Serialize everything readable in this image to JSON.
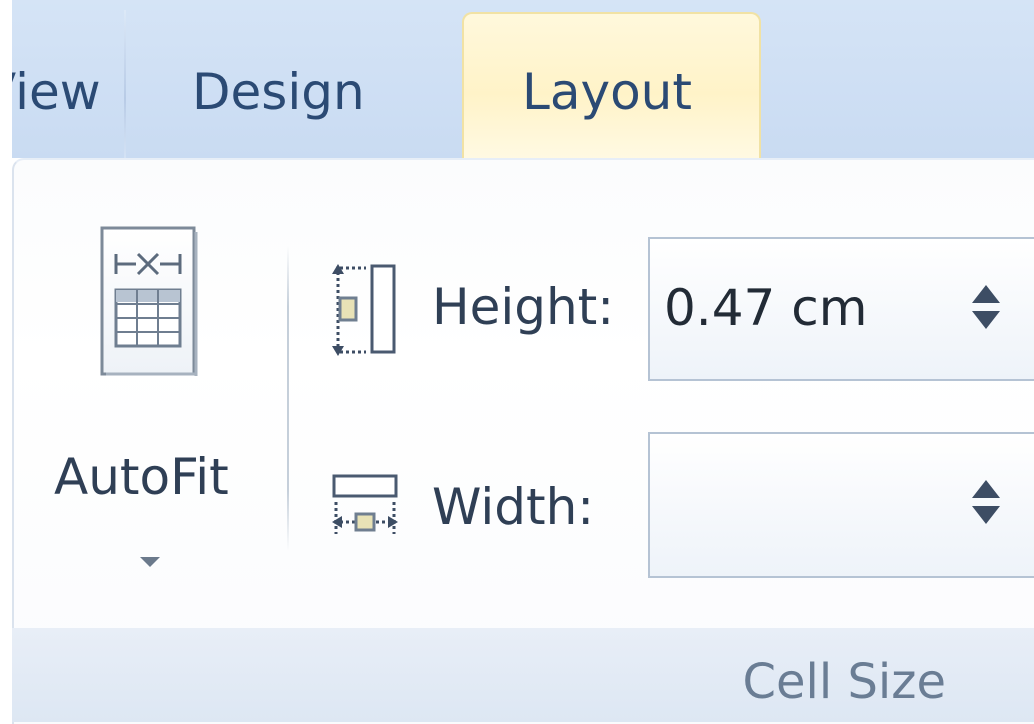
{
  "tabs": {
    "partial_label": "View",
    "design_label": "Design",
    "layout_label": "Layout",
    "active": "Layout"
  },
  "autofit": {
    "label": "AutoFit",
    "icon": "autofit-table-icon"
  },
  "cell_size": {
    "group_label": "Cell Size",
    "height": {
      "label": "Height:",
      "value": "0.47 cm",
      "icon": "row-height-icon"
    },
    "width": {
      "label": "Width:",
      "value": "",
      "icon": "column-width-icon"
    }
  },
  "colors": {
    "tab_bar": "#c9dbf2",
    "active_tab": "#fff3c8",
    "text": "#2f3f55",
    "footer": "#dde7f3"
  }
}
